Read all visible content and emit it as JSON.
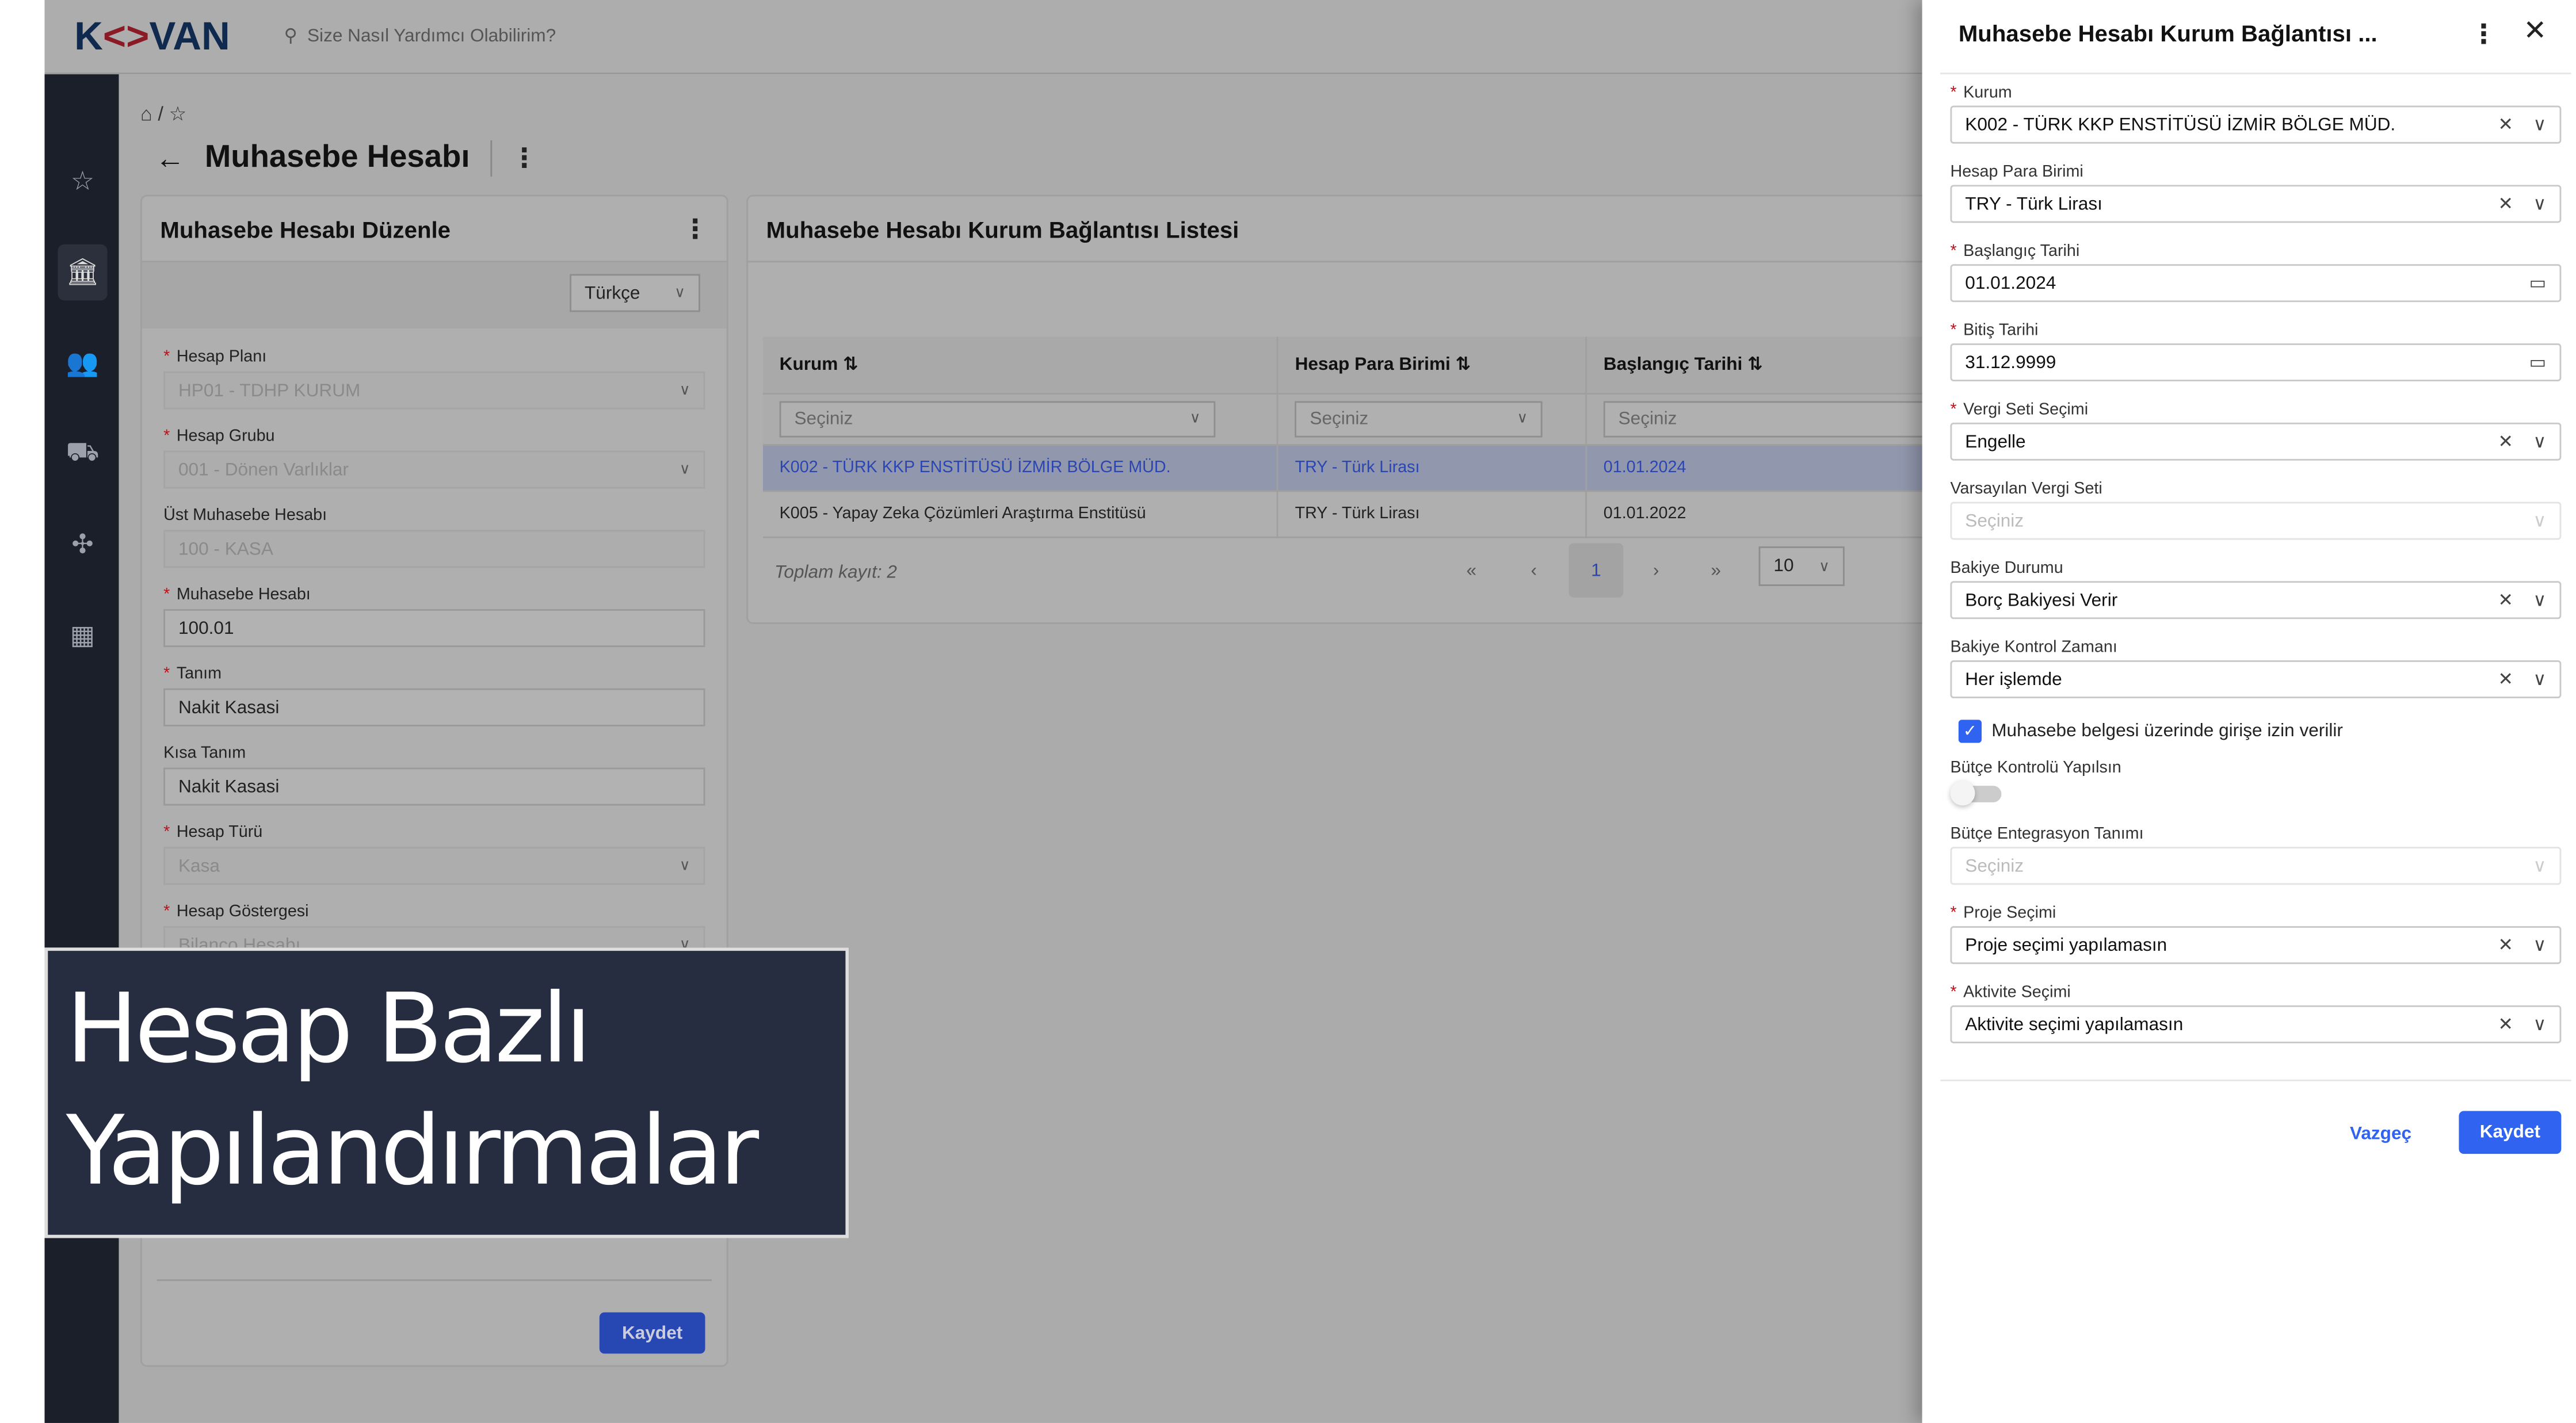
{
  "topbar": {
    "logo": "KOVAN",
    "search_placeholder": "Size Nasıl Yardımcı Olabilirim?"
  },
  "page": {
    "title": "Muhasebe Hesabı",
    "crumb_sep": "/"
  },
  "edit_card": {
    "title": "Muhasebe Hesabı Düzenle",
    "language": "Türkçe",
    "save": "Kaydet",
    "fields": [
      {
        "label": "Hesap Planı",
        "value": "HP01 - TDHP KURUM",
        "required": true,
        "disabled": true,
        "select": true
      },
      {
        "label": "Hesap Grubu",
        "value": "001 - Dönen Varlıklar",
        "required": true,
        "disabled": true,
        "select": true
      },
      {
        "label": "Üst Muhasebe Hesabı",
        "value": "100 - KASA",
        "required": false,
        "disabled": true,
        "select": false
      },
      {
        "label": "Muhasebe Hesabı",
        "value": "100.01",
        "required": true,
        "disabled": false,
        "select": false
      },
      {
        "label": "Tanım",
        "value": "Nakit Kasasi",
        "required": true,
        "disabled": false,
        "select": false
      },
      {
        "label": "Kısa Tanım",
        "value": "Nakit Kasasi",
        "required": false,
        "disabled": false,
        "select": false
      },
      {
        "label": "Hesap Türü",
        "value": "Kasa",
        "required": true,
        "disabled": true,
        "select": true
      },
      {
        "label": "Hesap Göstergesi",
        "value": "Bilanço Hesabı",
        "required": true,
        "disabled": true,
        "select": true
      }
    ]
  },
  "list_card": {
    "title": "Muhasebe Hesabı Kurum Bağlantısı Listesi",
    "columns": [
      "Kurum",
      "Hesap Para Birimi",
      "Başlangıç Tarihi"
    ],
    "filter_placeholder": "Seçiniz",
    "rows": [
      [
        "K002 - TÜRK KKP ENSTİTÜSÜ İZMİR BÖLGE MÜD.",
        "TRY - Türk Lirası",
        "01.01.2024"
      ],
      [
        "K005 - Yapay Zeka Çözümleri Araştırma Enstitüsü",
        "TRY - Türk Lirası",
        "01.01.2022"
      ]
    ],
    "total": "Toplam kayıt: 2",
    "page": "1",
    "page_size": "10"
  },
  "drawer": {
    "title": "Muhasebe Hesabı Kurum Bağlantısı ...",
    "fields": [
      {
        "label": "Kurum",
        "value": "K002 - TÜRK KKP ENSTİTÜSÜ İZMİR BÖLGE MÜD.",
        "required": true,
        "type": "select-clear"
      },
      {
        "label": "Hesap Para Birimi",
        "value": "TRY - Türk Lirası",
        "required": false,
        "type": "select-clear"
      },
      {
        "label": "Başlangıç Tarihi",
        "value": "01.01.2024",
        "required": true,
        "type": "date"
      },
      {
        "label": "Bitiş Tarihi",
        "value": "31.12.9999",
        "required": true,
        "type": "date"
      },
      {
        "label": "Vergi Seti Seçimi",
        "value": "Engelle",
        "required": true,
        "type": "select-clear"
      },
      {
        "label": "Varsayılan Vergi Seti",
        "value": "Seçiniz",
        "required": false,
        "type": "placeholder"
      },
      {
        "label": "Bakiye Durumu",
        "value": "Borç Bakiyesi Verir",
        "required": false,
        "type": "select-clear"
      },
      {
        "label": "Bakiye Kontrol Zamanı",
        "value": "Her işlemde",
        "required": false,
        "type": "select-clear"
      }
    ],
    "checkbox": {
      "label": "Muhasebe belgesi üzerinde girişe izin verilir",
      "checked": true
    },
    "toggle": {
      "label": "Bütçe Kontrolü Yapılsın",
      "on": false
    },
    "fields2": [
      {
        "label": "Bütçe Entegrasyon Tanımı",
        "value": "Seçiniz",
        "required": false,
        "type": "placeholder"
      },
      {
        "label": "Proje Seçimi",
        "value": "Proje seçimi yapılamasın",
        "required": true,
        "type": "select-clear"
      },
      {
        "label": "Aktivite Seçimi",
        "value": "Aktivite seçimi yapılamasın",
        "required": true,
        "type": "select-clear"
      }
    ],
    "cancel": "Vazgeç",
    "save": "Kaydet"
  },
  "overlay": {
    "line1": "Hesap Bazlı",
    "line2": "Yapılandırmalar"
  },
  "colors": {
    "primary": "#2f63f0",
    "sidebar": "#1b1f2a",
    "overlay": "#272d40",
    "required": "#e0202a"
  }
}
